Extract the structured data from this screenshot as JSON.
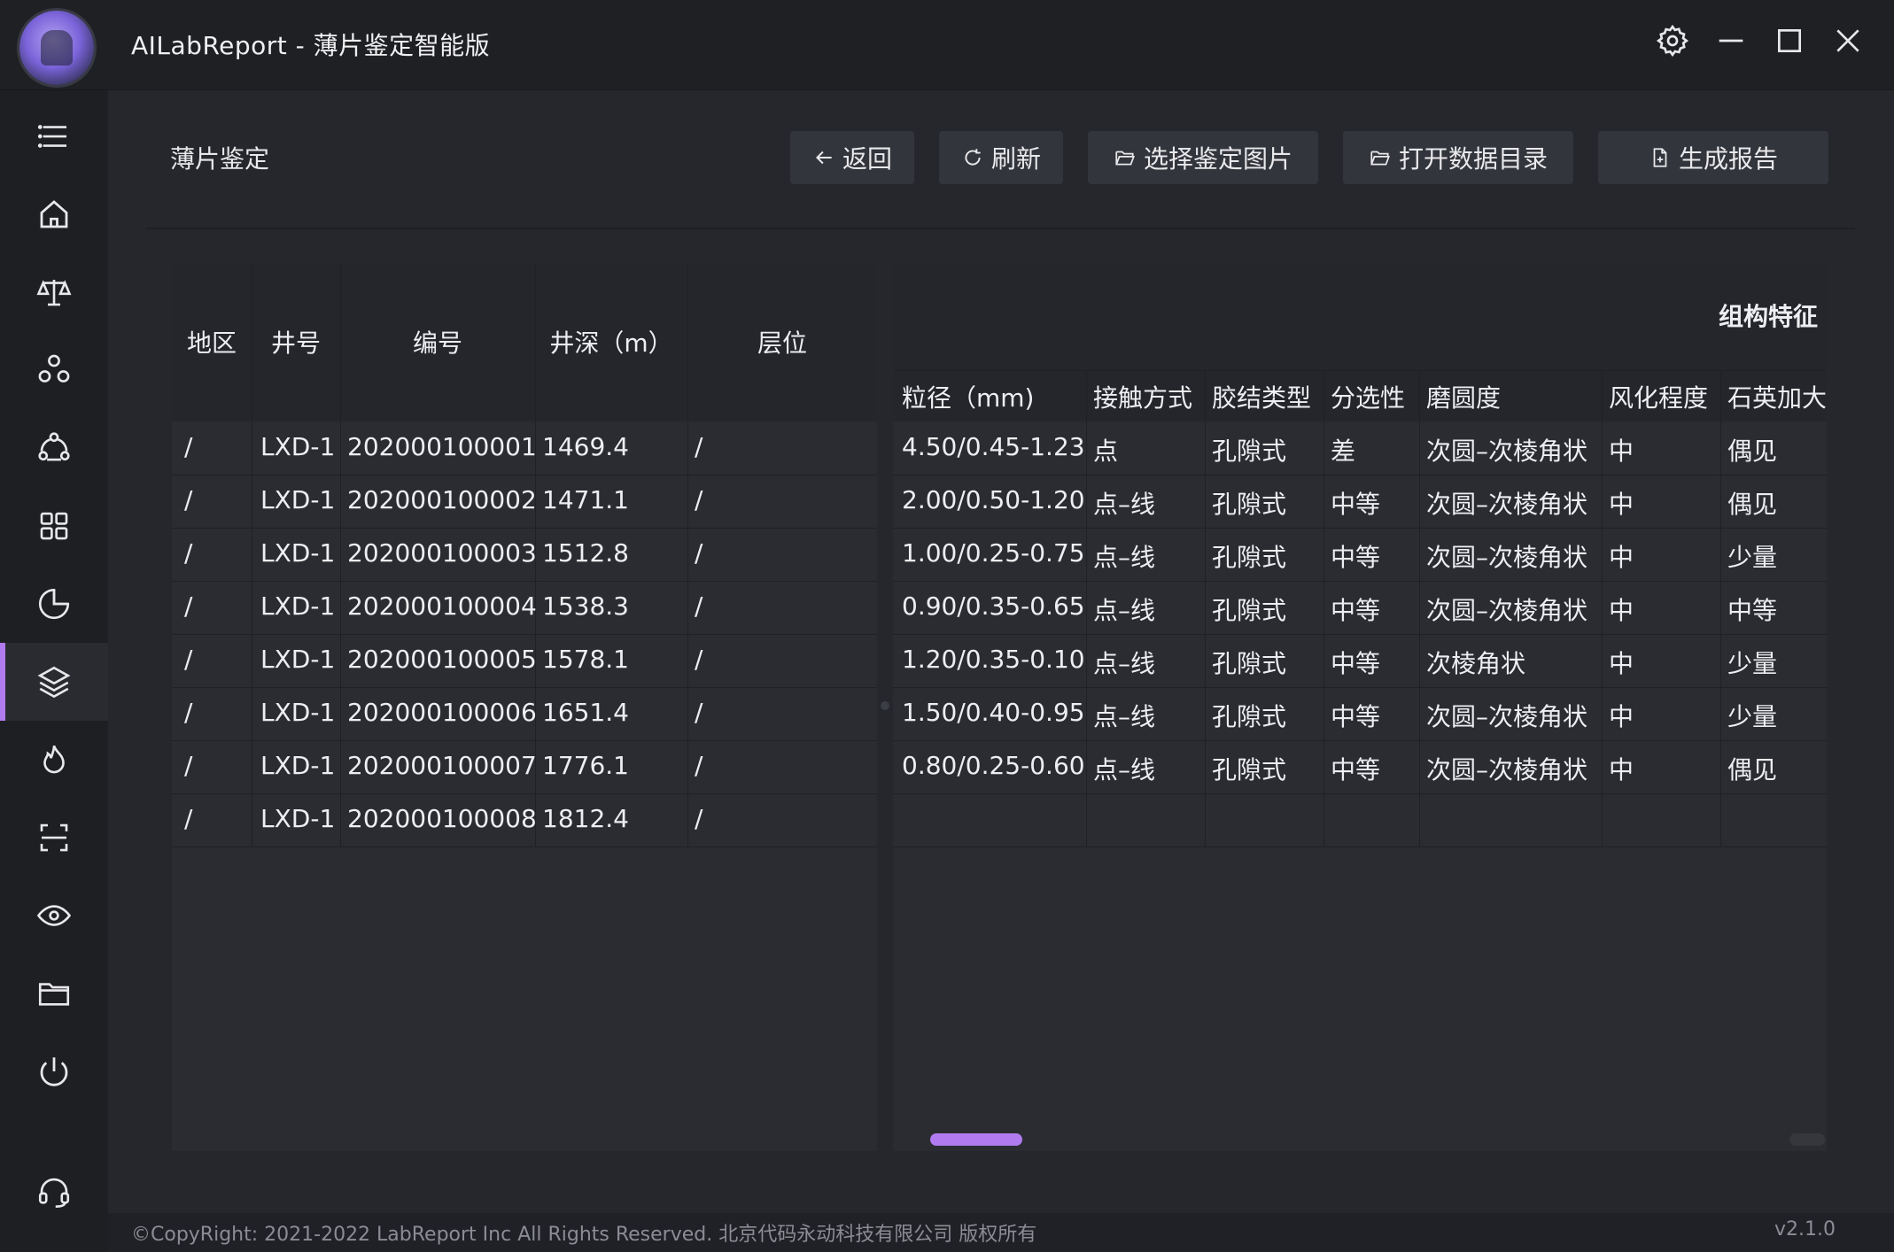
{
  "app": {
    "title": "AILabReport - 薄片鉴定智能版"
  },
  "titlebar_icons": [
    "settings-icon",
    "minimize-icon",
    "maximize-icon",
    "close-icon"
  ],
  "sidebar": {
    "items": [
      {
        "icon": "menu-icon"
      },
      {
        "icon": "home-icon"
      },
      {
        "icon": "scale-icon"
      },
      {
        "icon": "molecule-icon"
      },
      {
        "icon": "recycle-icon"
      },
      {
        "icon": "grid-icon"
      },
      {
        "icon": "pie-chart-icon"
      },
      {
        "icon": "layers-icon",
        "active": true
      },
      {
        "icon": "flame-icon"
      },
      {
        "icon": "scan-icon"
      },
      {
        "icon": "eye-icon"
      },
      {
        "icon": "folder-icon"
      },
      {
        "icon": "power-icon"
      },
      {
        "icon": "headset-icon"
      }
    ]
  },
  "page": {
    "title": "薄片鉴定"
  },
  "toolbar": {
    "back": "返回",
    "refresh": "刷新",
    "select_images": "选择鉴定图片",
    "open_data_dir": "打开数据目录",
    "generate_report": "生成报告"
  },
  "left_table": {
    "headers": [
      "地区",
      "井号",
      "编号",
      "井深（m）",
      "层位"
    ],
    "rows": [
      [
        "/",
        "LXD-1",
        "202000100001",
        "1469.4",
        "/"
      ],
      [
        "/",
        "LXD-1",
        "202000100002",
        "1471.1",
        "/"
      ],
      [
        "/",
        "LXD-1",
        "202000100003",
        "1512.8",
        "/"
      ],
      [
        "/",
        "LXD-1",
        "202000100004",
        "1538.3",
        "/"
      ],
      [
        "/",
        "LXD-1",
        "202000100005",
        "1578.1",
        "/"
      ],
      [
        "/",
        "LXD-1",
        "202000100006",
        "1651.4",
        "/"
      ],
      [
        "/",
        "LXD-1",
        "202000100007",
        "1776.1",
        "/"
      ],
      [
        "/",
        "LXD-1",
        "202000100008",
        "1812.4",
        "/"
      ]
    ]
  },
  "right_table": {
    "group_header": "组构特征",
    "headers": [
      "粒径（mm)",
      "接触方式",
      "胶结类型",
      "分选性",
      "磨圆度",
      "风化程度",
      "石英加大"
    ],
    "rows": [
      [
        "4.50/0.45-1.23",
        "点",
        "孔隙式",
        "差",
        "次圆–次棱角状",
        "中",
        "偶见"
      ],
      [
        "2.00/0.50-1.20",
        "点–线",
        "孔隙式",
        "中等",
        "次圆–次棱角状",
        "中",
        "偶见"
      ],
      [
        "1.00/0.25-0.75",
        "点–线",
        "孔隙式",
        "中等",
        "次圆–次棱角状",
        "中",
        "少量"
      ],
      [
        "0.90/0.35-0.65",
        "点–线",
        "孔隙式",
        "中等",
        "次圆–次棱角状",
        "中",
        "中等"
      ],
      [
        "1.20/0.35-0.10",
        "点–线",
        "孔隙式",
        "中等",
        "次棱角状",
        "中",
        "少量"
      ],
      [
        "1.50/0.40-0.95",
        "点–线",
        "孔隙式",
        "中等",
        "次圆–次棱角状",
        "中",
        "少量"
      ],
      [
        "0.80/0.25-0.60",
        "点–线",
        "孔隙式",
        "中等",
        "次圆–次棱角状",
        "中",
        "偶见"
      ]
    ],
    "scroll_position": 0.04
  },
  "footer": {
    "copyright": "©CopyRight: 2021-2022 LabReport Inc All Rights Reserved. 北京代码永动科技有限公司 版权所有",
    "version": "v2.1.0"
  },
  "colors": {
    "accent": "#b17bef",
    "background": "#25272c",
    "sidebar": "#1e1f23",
    "button": "#33353c"
  }
}
